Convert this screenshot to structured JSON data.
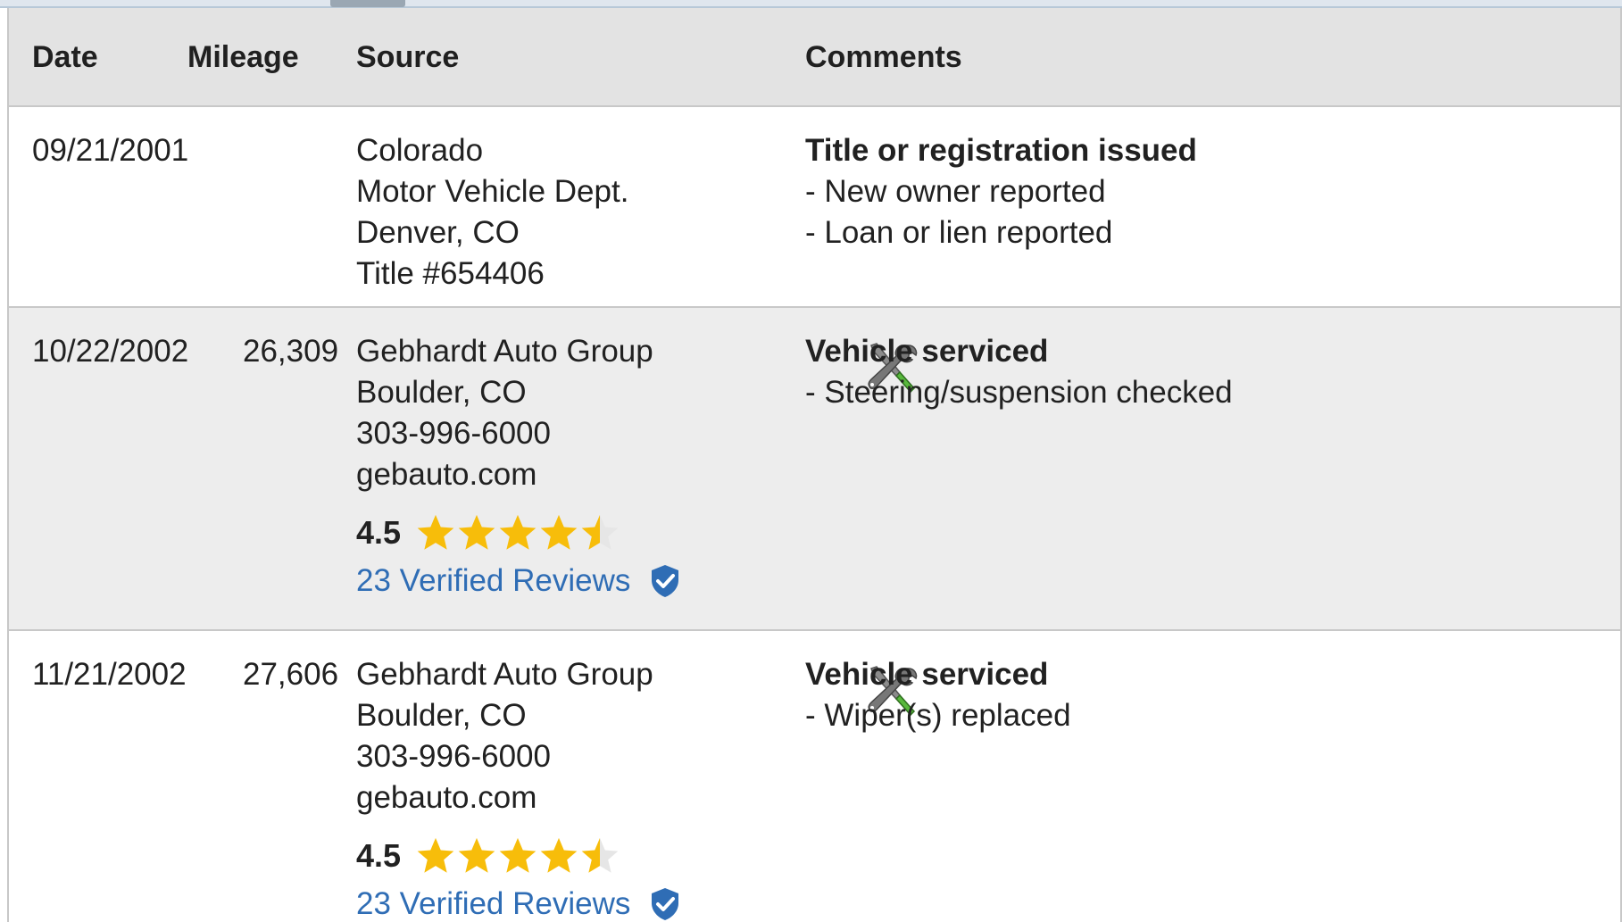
{
  "table": {
    "headers": {
      "date": "Date",
      "mileage": "Mileage",
      "source": "Source",
      "comments": "Comments"
    },
    "rows": [
      {
        "date": "09/21/2001",
        "mileage": "",
        "source": [
          "Colorado",
          "Motor Vehicle Dept.",
          "Denver, CO",
          "Title #654406"
        ],
        "comment_title": "Title or registration issued",
        "comment_items": [
          "- New owner reported",
          "- Loan or lien reported"
        ],
        "icon": null,
        "rating": null
      },
      {
        "date": "10/22/2002",
        "mileage": "26,309",
        "source": [
          "Gebhardt Auto Group",
          "Boulder, CO",
          "303-996-6000",
          "gebauto.com"
        ],
        "comment_title": "Vehicle serviced",
        "comment_items": [
          "- Steering/suspension checked"
        ],
        "icon": "service-tools-icon",
        "rating": {
          "value": "4.5",
          "stars": 4.5,
          "reviews_label": "23 Verified Reviews",
          "verified_icon": "verified-shield-check-icon"
        }
      },
      {
        "date": "11/21/2002",
        "mileage": "27,606",
        "source": [
          "Gebhardt Auto Group",
          "Boulder, CO",
          "303-996-6000",
          "gebauto.com"
        ],
        "comment_title": "Vehicle serviced",
        "comment_items": [
          "- Wiper(s) replaced"
        ],
        "icon": "service-tools-icon",
        "rating": {
          "value": "4.5",
          "stars": 4.5,
          "reviews_label": "23 Verified Reviews",
          "verified_icon": "verified-shield-check-icon"
        }
      }
    ]
  },
  "colors": {
    "header_bg": "#e3e3e3",
    "alt_row_bg": "#ededed",
    "star_gold": "#f7bd0a",
    "star_empty": "#e6e6e6",
    "link_blue": "#2f6db5",
    "verified_blue": "#2f6db5",
    "tool_green": "#58b83c"
  }
}
